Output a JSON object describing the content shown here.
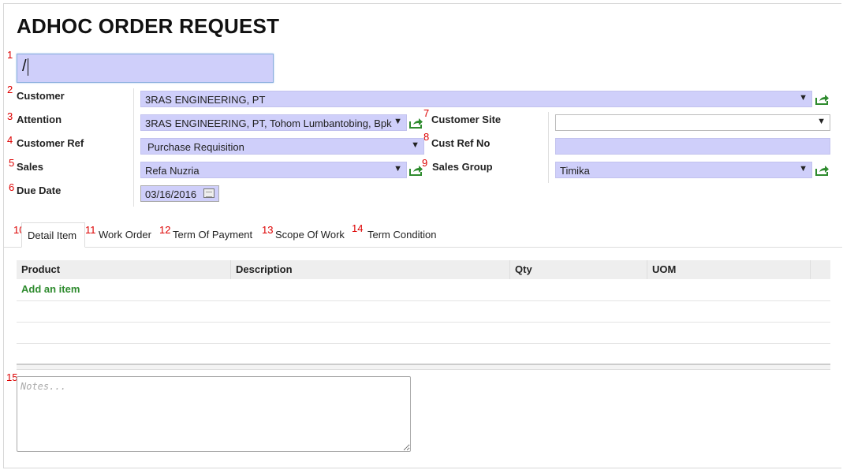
{
  "page": {
    "title": "ADHOC ORDER REQUEST",
    "name_value": "/"
  },
  "markers": [
    "1",
    "2",
    "3",
    "4",
    "5",
    "6",
    "7",
    "8",
    "9",
    "10",
    "11",
    "12",
    "13",
    "14",
    "15"
  ],
  "form": {
    "customer": {
      "label": "Customer",
      "value": "3RAS ENGINEERING, PT"
    },
    "attention": {
      "label": "Attention",
      "value": "3RAS ENGINEERING, PT, Tohom Lumbantobing, Bpk"
    },
    "customer_ref": {
      "label": "Customer Ref",
      "value": "Purchase Requisition"
    },
    "sales": {
      "label": "Sales",
      "value": "Refa Nuzria"
    },
    "due_date": {
      "label": "Due Date",
      "value": "03/16/2016"
    },
    "customer_site": {
      "label": "Customer Site",
      "value": ""
    },
    "cust_ref_no": {
      "label": "Cust Ref No",
      "value": ""
    },
    "sales_group": {
      "label": "Sales Group",
      "value": "Timika"
    }
  },
  "tabs": [
    {
      "label": "Detail Item",
      "active": true
    },
    {
      "label": "Work Order",
      "active": false
    },
    {
      "label": "Term Of Payment",
      "active": false
    },
    {
      "label": "Scope Of Work",
      "active": false
    },
    {
      "label": "Term Condition",
      "active": false
    }
  ],
  "table": {
    "columns": [
      "Product",
      "Description",
      "Qty",
      "UOM"
    ],
    "add_item_label": "Add an item"
  },
  "notes": {
    "placeholder": "Notes..."
  },
  "colors": {
    "field_bg": "#cfcffa",
    "marker": "#dd0000",
    "link_green": "#2e8b2e",
    "external_icon": "#2e8b2e"
  },
  "icons": {
    "external_link": "external-link-icon",
    "dropdown": "chevron-down-icon",
    "calendar": "calendar-icon"
  }
}
